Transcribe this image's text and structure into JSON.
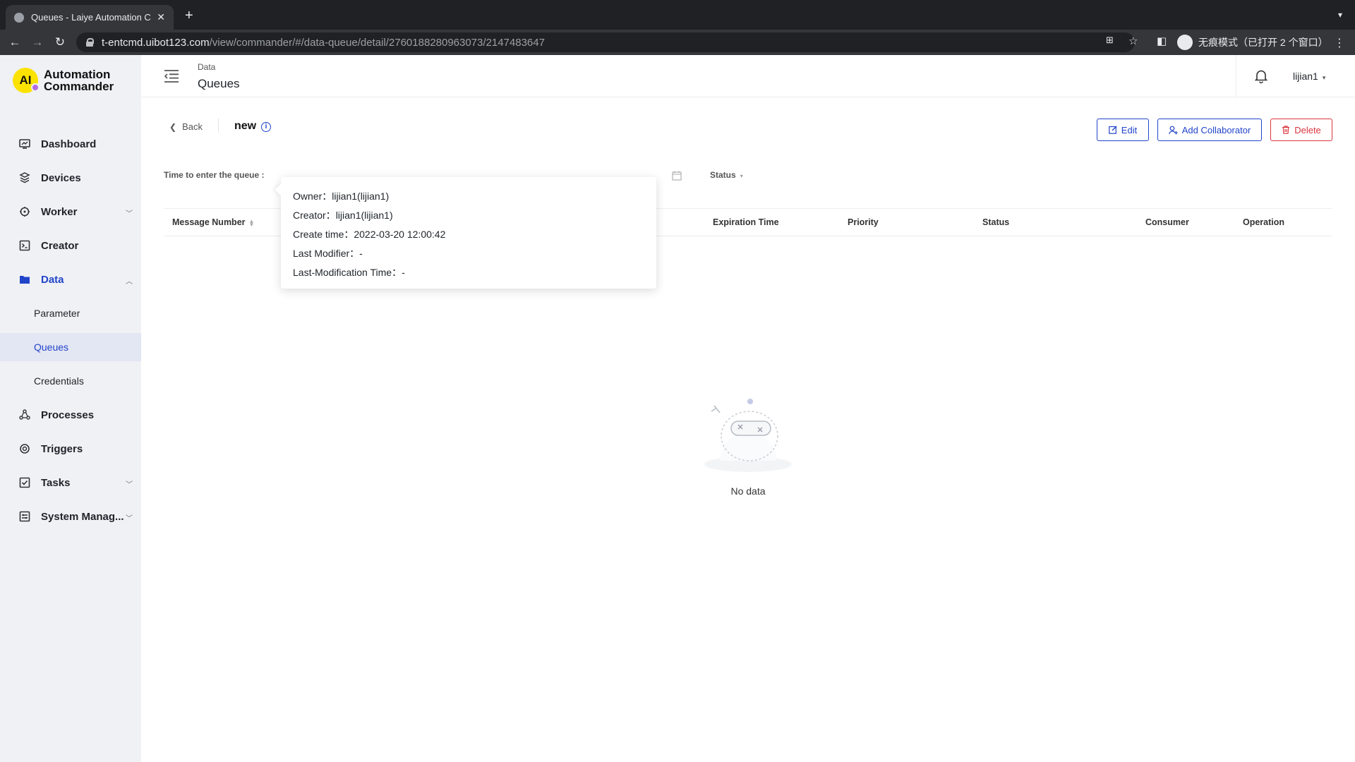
{
  "browser": {
    "tab_title": "Queues - Laiye Automation Co",
    "url_host": "t-entcmd.uibot123.com",
    "url_path": "/view/commander/#/data-queue/detail/2760188280963073/2147483647",
    "incognito_label": "无痕模式（已打开 2 个窗口）"
  },
  "brand": {
    "line1": "Automation",
    "line2": "Commander",
    "mark": "AI"
  },
  "sidebar": {
    "items": [
      {
        "label": "Dashboard",
        "icon": "dashboard-icon"
      },
      {
        "label": "Devices",
        "icon": "devices-icon"
      },
      {
        "label": "Worker",
        "icon": "worker-icon"
      },
      {
        "label": "Creator",
        "icon": "creator-icon"
      },
      {
        "label": "Data",
        "icon": "data-folder-icon"
      },
      {
        "label": "Processes",
        "icon": "processes-icon"
      },
      {
        "label": "Triggers",
        "icon": "triggers-icon"
      },
      {
        "label": "Tasks",
        "icon": "tasks-icon"
      },
      {
        "label": "System Manag...",
        "icon": "system-icon"
      }
    ],
    "data_children": [
      "Parameter",
      "Queues",
      "Credentials"
    ]
  },
  "header": {
    "parent": "Data",
    "title": "Queues",
    "username": "lijian1"
  },
  "detail": {
    "back_label": "Back",
    "queue_name": "new",
    "buttons": {
      "edit": "Edit",
      "add_collaborator": "Add Collaborator",
      "delete": "Delete"
    },
    "filter_time_label": "Time to enter the queue :",
    "filter_status_label": "Status"
  },
  "table": {
    "columns": [
      "Message Number",
      "Expiration Time",
      "Priority",
      "Status",
      "Consumer",
      "Operation"
    ],
    "empty_text": "No data"
  },
  "popover": {
    "rows": [
      {
        "label": "Owner：",
        "value": "lijian1(lijian1)"
      },
      {
        "label": "Creator：",
        "value": "lijian1(lijian1)"
      },
      {
        "label": "Create time：",
        "value": "2022-03-20 12:00:42"
      },
      {
        "label": "Last Modifier：",
        "value": "-"
      },
      {
        "label": "Last-Modification Time：",
        "value": "-"
      }
    ]
  },
  "colors": {
    "primary": "#2145c9",
    "danger": "#d9363e",
    "brand_yellow": "#fbe200"
  }
}
